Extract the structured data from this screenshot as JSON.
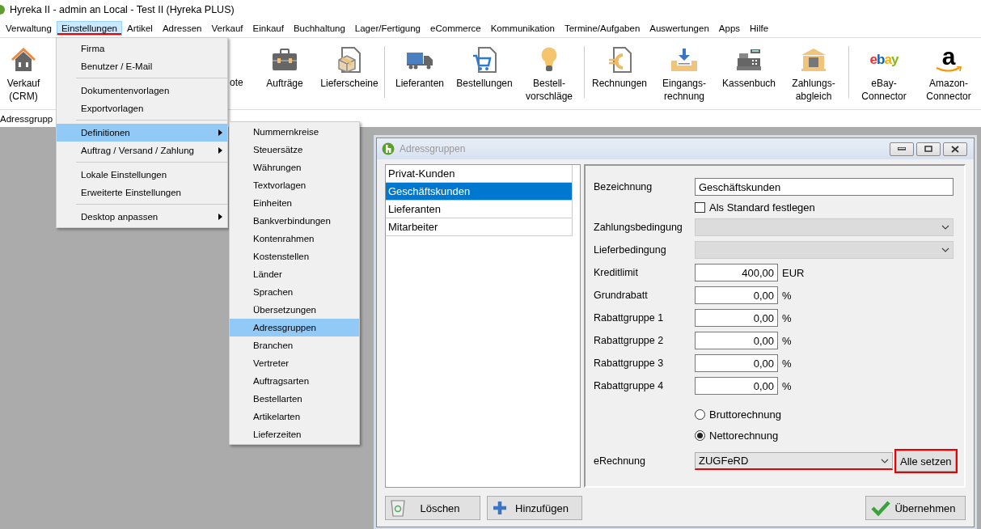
{
  "window": {
    "title": "Hyreka II - admin an Local - Test II (Hyreka PLUS)"
  },
  "menubar": [
    {
      "label": "Verwaltung",
      "selected": false,
      "marked": false
    },
    {
      "label": "Einstellungen",
      "selected": true,
      "marked": true
    },
    {
      "label": "Artikel",
      "selected": false,
      "marked": false
    },
    {
      "label": "Adressen",
      "selected": false,
      "marked": false
    },
    {
      "label": "Verkauf",
      "selected": false,
      "marked": false
    },
    {
      "label": "Einkauf",
      "selected": false,
      "marked": false
    },
    {
      "label": "Buchhaltung",
      "selected": false,
      "marked": false
    },
    {
      "label": "Lager/Fertigung",
      "selected": false,
      "marked": false
    },
    {
      "label": "eCommerce",
      "selected": false,
      "marked": false
    },
    {
      "label": "Kommunikation",
      "selected": false,
      "marked": false
    },
    {
      "label": "Termine/Aufgaben",
      "selected": false,
      "marked": false
    },
    {
      "label": "Auswertungen",
      "selected": false,
      "marked": false
    },
    {
      "label": "Apps",
      "selected": false,
      "marked": false
    },
    {
      "label": "Hilfe",
      "selected": false,
      "marked": false
    }
  ],
  "toolbar": [
    {
      "kind": "button",
      "label": "Verkauf\n(CRM)"
    },
    {
      "kind": "partial",
      "label": "ote"
    },
    {
      "kind": "button",
      "label": "Aufträge"
    },
    {
      "kind": "button",
      "label": "Lieferscheine"
    },
    {
      "kind": "separator"
    },
    {
      "kind": "button",
      "label": "Lieferanten"
    },
    {
      "kind": "button",
      "label": "Bestellungen"
    },
    {
      "kind": "button",
      "label": "Bestell-\nvorschläge"
    },
    {
      "kind": "separator"
    },
    {
      "kind": "button",
      "label": "Rechnungen"
    },
    {
      "kind": "button",
      "label": "Eingangs-\nrechnung"
    },
    {
      "kind": "button",
      "label": "Kassenbuch"
    },
    {
      "kind": "button",
      "label": "Zahlungs-\nabgleich"
    },
    {
      "kind": "separator"
    },
    {
      "kind": "button",
      "label": "eBay-\nConnector",
      "logo_text": "ebay"
    },
    {
      "kind": "button",
      "label": "Amazon-\nConnector",
      "logo_text": "a"
    }
  ],
  "tab_strip": {
    "label": "Adressgrupp"
  },
  "menu": [
    {
      "kind": "item",
      "label": "Firma",
      "selected": false,
      "submenu": false
    },
    {
      "kind": "item",
      "label": "Benutzer / E-Mail",
      "selected": false,
      "submenu": false
    },
    {
      "kind": "separator"
    },
    {
      "kind": "item",
      "label": "Dokumentenvorlagen",
      "selected": false,
      "submenu": false
    },
    {
      "kind": "item",
      "label": "Exportvorlagen",
      "selected": false,
      "submenu": false
    },
    {
      "kind": "separator"
    },
    {
      "kind": "item",
      "label": "Definitionen",
      "selected": true,
      "submenu": true
    },
    {
      "kind": "item",
      "label": "Auftrag / Versand / Zahlung",
      "selected": false,
      "submenu": true
    },
    {
      "kind": "separator"
    },
    {
      "kind": "item",
      "label": "Lokale Einstellungen",
      "selected": false,
      "submenu": false
    },
    {
      "kind": "item",
      "label": "Erweiterte Einstellungen",
      "selected": false,
      "submenu": false
    },
    {
      "kind": "separator"
    },
    {
      "kind": "item",
      "label": "Desktop anpassen",
      "selected": false,
      "submenu": true
    }
  ],
  "submenu": [
    {
      "label": "Nummernkreise",
      "selected": false
    },
    {
      "label": "Steuersätze",
      "selected": false
    },
    {
      "label": "Währungen",
      "selected": false
    },
    {
      "label": "Textvorlagen",
      "selected": false
    },
    {
      "label": "Einheiten",
      "selected": false
    },
    {
      "label": "Bankverbindungen",
      "selected": false
    },
    {
      "label": "Kontenrahmen",
      "selected": false
    },
    {
      "label": "Kostenstellen",
      "selected": false
    },
    {
      "label": "Länder",
      "selected": false
    },
    {
      "label": "Sprachen",
      "selected": false
    },
    {
      "label": "Übersetzungen",
      "selected": false
    },
    {
      "label": "Adressgruppen",
      "selected": true
    },
    {
      "label": "Branchen",
      "selected": false
    },
    {
      "label": "Vertreter",
      "selected": false
    },
    {
      "label": "Auftragsarten",
      "selected": false
    },
    {
      "label": "Bestellarten",
      "selected": false
    },
    {
      "label": "Artikelarten",
      "selected": false
    },
    {
      "label": "Lieferzeiten",
      "selected": false
    }
  ],
  "dialog": {
    "title": "Adressgruppen",
    "groups": [
      {
        "label": "Privat-Kunden",
        "selected": false
      },
      {
        "label": "Geschäftskunden",
        "selected": true
      },
      {
        "label": "Lieferanten",
        "selected": false
      },
      {
        "label": "Mitarbeiter",
        "selected": false
      }
    ],
    "form": [
      {
        "kind": "text",
        "label": "Bezeichnung",
        "value": "Geschäftskunden"
      },
      {
        "kind": "checkbox",
        "label": "Als Standard festlegen",
        "checked": false
      },
      {
        "kind": "select",
        "label": "Zahlungsbedingung",
        "disabled": true
      },
      {
        "kind": "select",
        "label": "Lieferbedingung",
        "disabled": true
      },
      {
        "kind": "amount",
        "label": "Kreditlimit",
        "value": "400,00",
        "unit": "EUR"
      },
      {
        "kind": "amount",
        "label": "Grundrabatt",
        "value": "0,00",
        "unit": "%"
      },
      {
        "kind": "amount",
        "label": "Rabattgruppe 1",
        "value": "0,00",
        "unit": "%"
      },
      {
        "kind": "amount",
        "label": "Rabattgruppe 2",
        "value": "0,00",
        "unit": "%"
      },
      {
        "kind": "amount",
        "label": "Rabattgruppe 3",
        "value": "0,00",
        "unit": "%"
      },
      {
        "kind": "amount",
        "label": "Rabattgruppe 4",
        "value": "0,00",
        "unit": "%"
      },
      {
        "kind": "radio",
        "label": "Bruttorechnung",
        "selected": false
      },
      {
        "kind": "radio",
        "label": "Nettorechnung",
        "selected": true
      },
      {
        "kind": "select",
        "label": "eRechnung",
        "value": "ZUGFeRD",
        "disabled": false,
        "marked": true,
        "button": {
          "label": "Alle setzen",
          "marked": true
        }
      }
    ],
    "buttons": [
      {
        "kind": "delete",
        "label": "Löschen"
      },
      {
        "kind": "add",
        "label": "Hinzufügen"
      },
      {
        "kind": "apply",
        "label": "Übernehmen"
      }
    ]
  }
}
